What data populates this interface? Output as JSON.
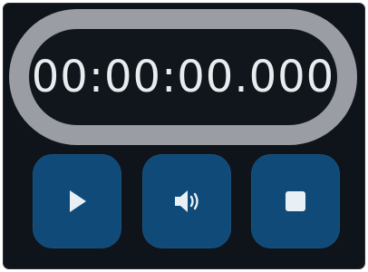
{
  "timer": {
    "display": "00:00:00.000"
  },
  "controls": {
    "play_icon": "play-icon",
    "sound_icon": "volume-icon",
    "stop_icon": "stop-icon"
  },
  "colors": {
    "panel_bg": "#0f141a",
    "ring": "#9a9da3",
    "button_bg": "#0f4a78",
    "icon": "#e8f0f6",
    "text": "#e9ecef"
  }
}
